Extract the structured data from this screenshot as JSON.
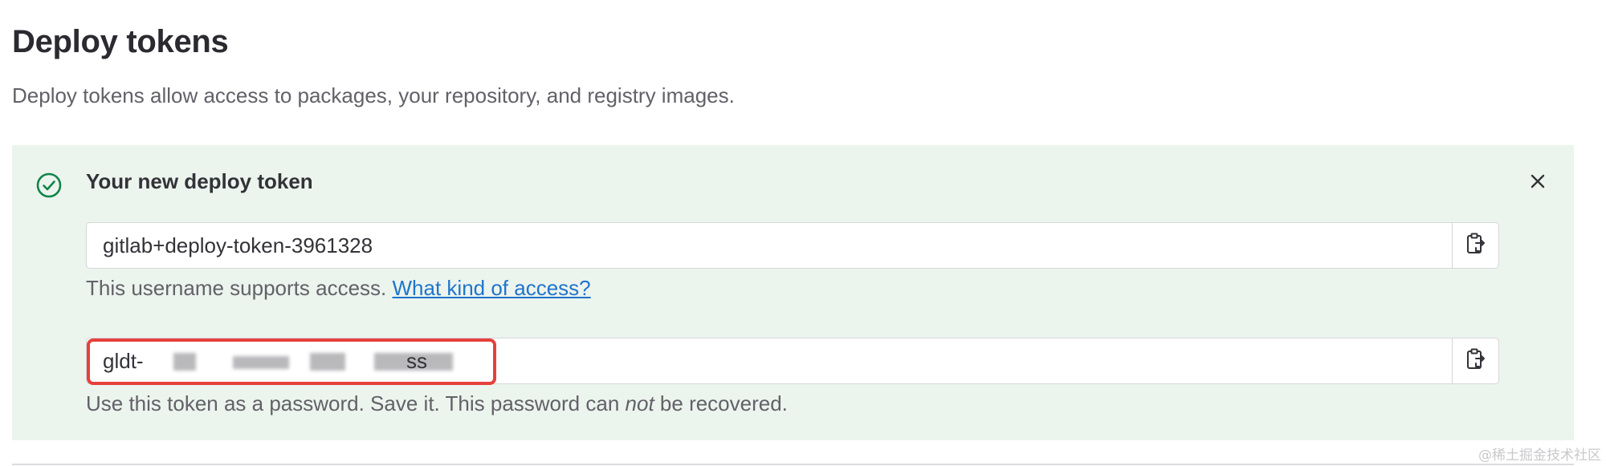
{
  "page": {
    "title": "Deploy tokens",
    "description": "Deploy tokens allow access to packages, your repository, and registry images."
  },
  "alert": {
    "title": "Your new deploy token",
    "status_icon": "check-circle-icon",
    "close_icon": "close-icon",
    "accent_color": "#108548"
  },
  "username_field": {
    "value": "gitlab+deploy-token-3961328",
    "help_prefix": "This username supports access.",
    "help_link": "What kind of access?",
    "copy_icon": "copy-to-clipboard-icon"
  },
  "token_field": {
    "value": "gldt-",
    "value_tail": "ss",
    "help_prefix": "Use this token as a password. Save it. This password can",
    "help_emphasis": "not",
    "help_suffix": "be recovered.",
    "copy_icon": "copy-to-clipboard-icon",
    "highlight_color": "#e5413a"
  },
  "watermark": "@稀土掘金技术社区"
}
